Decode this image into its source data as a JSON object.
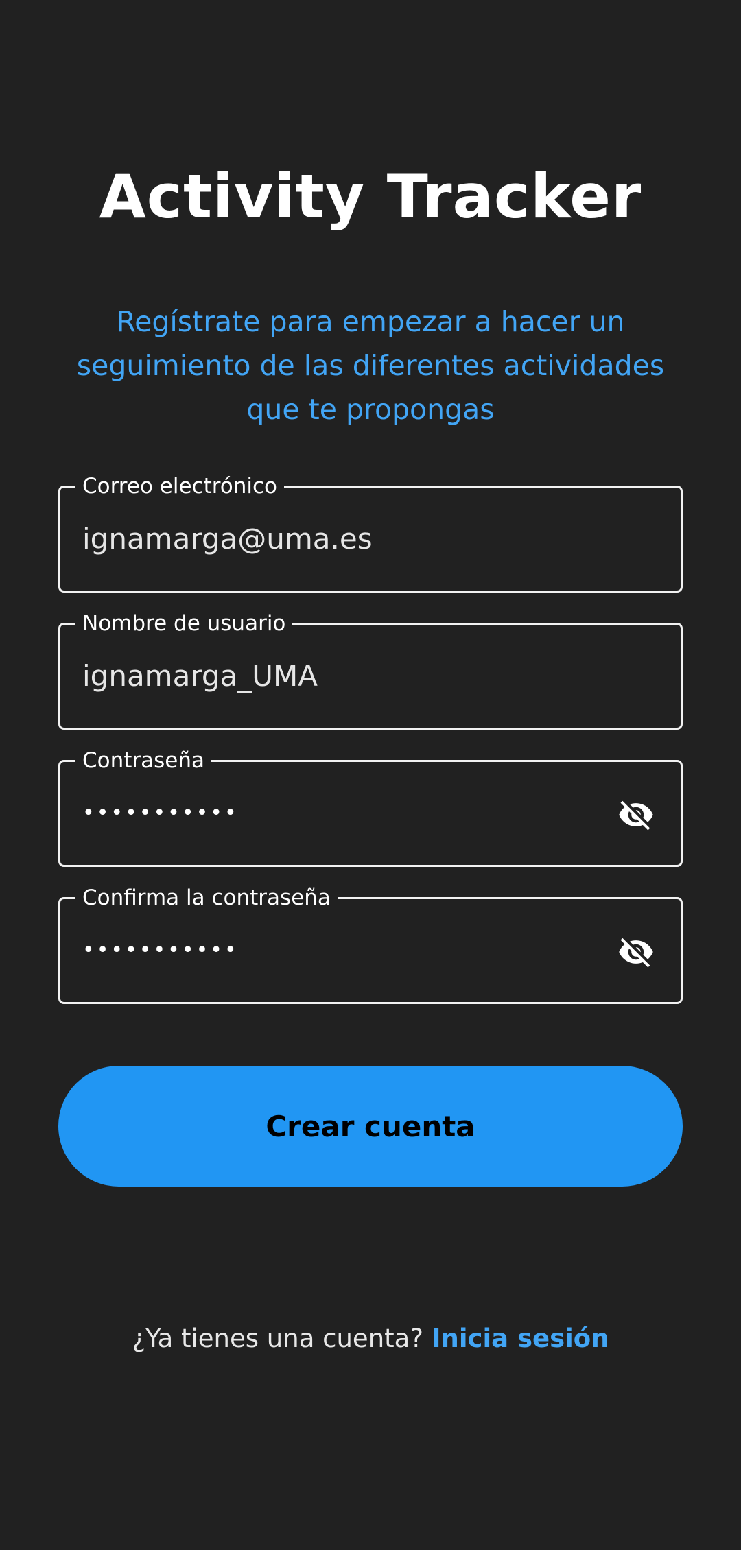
{
  "header": {
    "title": "Activity Tracker",
    "subtitle": "Regístrate para empezar a hacer un seguimiento de las diferentes actividades que te propongas"
  },
  "form": {
    "email": {
      "label": "Correo electrónico",
      "value": "ignamarga@uma.es"
    },
    "username": {
      "label": "Nombre de usuario",
      "value": "ignamarga_UMA"
    },
    "password": {
      "label": "Contraseña",
      "value": "•••••••••••",
      "icon": "visibility-off-icon"
    },
    "confirm_password": {
      "label": "Confirma la contraseña",
      "value": "•••••••••••",
      "icon": "visibility-off-icon"
    }
  },
  "actions": {
    "create_account_label": "Crear cuenta"
  },
  "footer": {
    "prompt": "¿Ya tienes una cuenta?",
    "login_link": "Inicia sesión"
  },
  "colors": {
    "background": "#212121",
    "accent": "#2196f3",
    "link": "#42a5f5",
    "text": "#ffffff"
  }
}
